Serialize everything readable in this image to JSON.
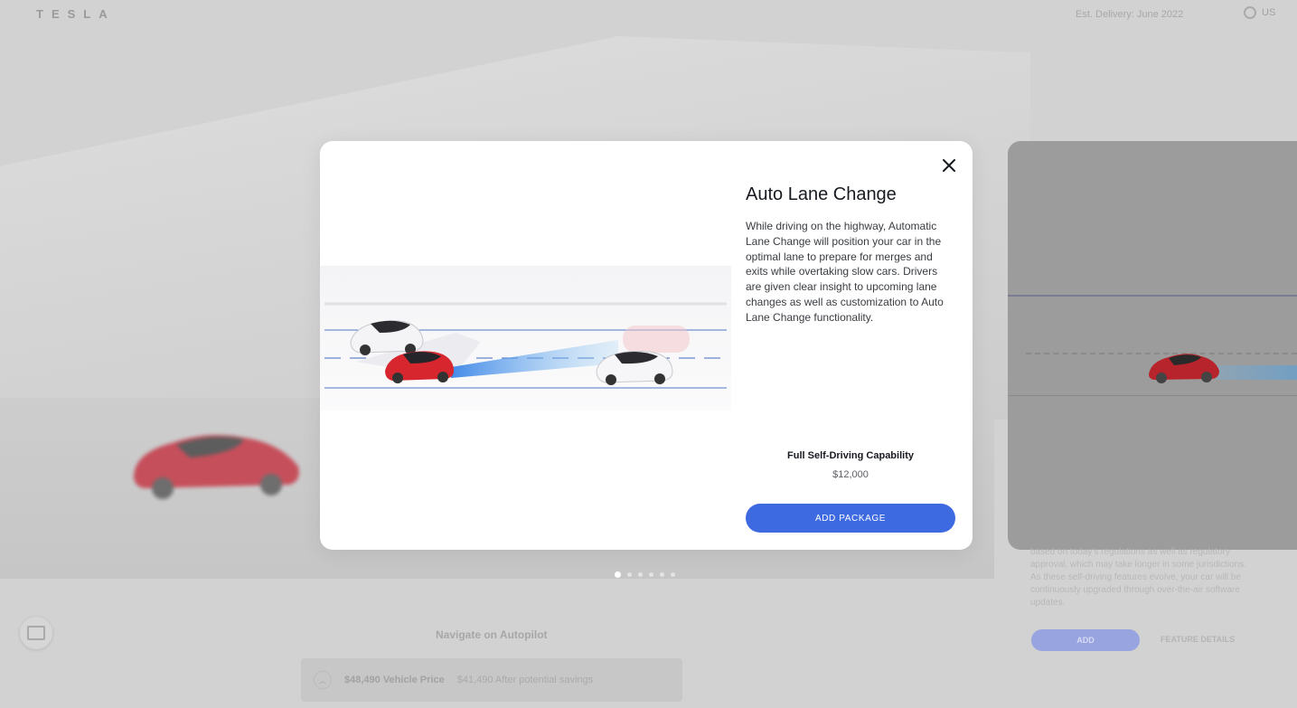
{
  "header": {
    "logo_text": "TESLA",
    "est_delivery": "Est. Delivery: June 2022",
    "locale": "US"
  },
  "modal": {
    "feature_title": "Auto Lane Change",
    "feature_description": "While driving on the highway, Automatic Lane Change will position your car in the optimal lane to prepare for merges and exits while overtaking slow cars. Drivers are given clear insight to upcoming lane changes as well as customization to Auto Lane Change functionality.",
    "package_name": "Full Self-Driving Capability",
    "package_price": "$12,000",
    "add_button_label": "ADD PACKAGE",
    "close_icon": "close-icon"
  },
  "carousel": {
    "dot_count": 6,
    "active_index": 0
  },
  "background": {
    "bottom_section_label": "Navigate on Autopilot",
    "vehicle_price": "$48,490 Vehicle Price",
    "after_savings": "$41,490 After potential savings",
    "side_panel_text": "based on today's regulations as well as regulatory approval, which may take longer in some jurisdictions. As these self-driving features evolve, your car will be continuously upgraded through over-the-air software updates.",
    "side_add_label": "ADD",
    "side_details_label": "FEATURE DETAILS"
  },
  "colors": {
    "accent": "#3e6ae1",
    "text_primary": "#171a20",
    "text_secondary": "#393c41",
    "car_red": "#c8232c"
  }
}
